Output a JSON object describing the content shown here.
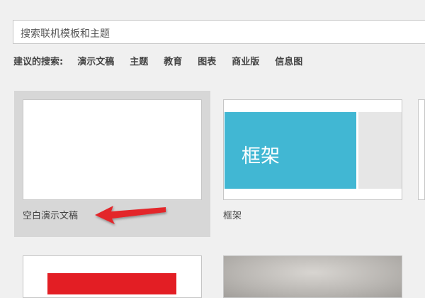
{
  "search": {
    "placeholder": "搜索联机模板和主题"
  },
  "suggestions": {
    "label": "建议的搜索:",
    "items": [
      "演示文稿",
      "主题",
      "教育",
      "图表",
      "商业版",
      "信息图"
    ]
  },
  "templates": [
    {
      "label": "空白演示文稿",
      "selected": true
    },
    {
      "label": "框架",
      "thumb_text": "框架"
    }
  ],
  "colors": {
    "background": "#f0f0f0",
    "selected_tile": "#d7d7d7",
    "frame_teal": "#41b7d3",
    "annotation_arrow": "#e3262b",
    "red_bar": "#e31e24"
  },
  "icons": {
    "annotation": "red-arrow-icon"
  }
}
